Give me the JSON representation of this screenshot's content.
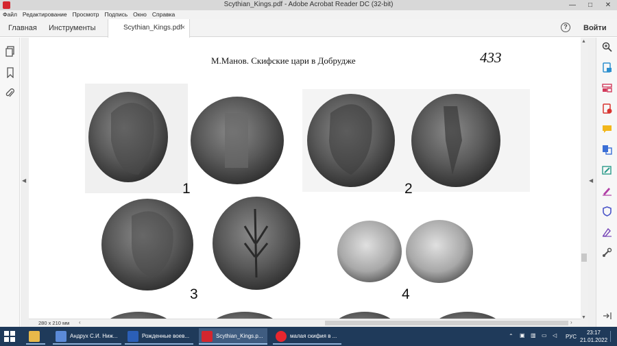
{
  "window": {
    "title": "Scythian_Kings.pdf - Adobe Acrobat Reader DC (32-bit)",
    "minimize": "—",
    "maximize": "□",
    "close": "✕"
  },
  "menu": [
    "Файл",
    "Редактирование",
    "Просмотр",
    "Подпись",
    "Окно",
    "Справка"
  ],
  "tabs": {
    "home": "Главная",
    "tools": "Инструменты",
    "document": "Scythian_Kings.pdf",
    "close_glyph": "×"
  },
  "header": {
    "help_glyph": "?",
    "login": "Войти"
  },
  "page": {
    "running_head": "М.Манов. Скифские цари в Добрудже",
    "page_number": "433",
    "coin_labels": [
      "1",
      "2",
      "3",
      "4"
    ]
  },
  "statusbar": {
    "page_size": "280 x 210 мм"
  },
  "left_tools": [
    "pages-icon",
    "bookmark-icon",
    "attachment-icon"
  ],
  "right_tools": [
    {
      "icon": "zoom-icon",
      "color": "#444444"
    },
    {
      "icon": "export-pdf-icon",
      "color": "#2c8fcf"
    },
    {
      "icon": "organize-pages-icon",
      "color": "#d23a5b"
    },
    {
      "icon": "create-pdf-icon",
      "color": "#d8342f"
    },
    {
      "icon": "comment-icon",
      "color": "#f2b71c"
    },
    {
      "icon": "combine-files-icon",
      "color": "#3b6fd6"
    },
    {
      "icon": "edit-pdf-icon",
      "color": "#2a9a8a"
    },
    {
      "icon": "fill-sign-icon",
      "color": "#b13fa6"
    },
    {
      "icon": "protect-icon",
      "color": "#4a55c8"
    },
    {
      "icon": "certificates-icon",
      "color": "#7a4ab8"
    },
    {
      "icon": "more-tools-icon",
      "color": "#555555"
    }
  ],
  "taskbar": {
    "items": [
      {
        "label": "",
        "color": "#e8b94a"
      },
      {
        "label": "Андрух С.И. Ниж...",
        "color": "#5b8ad8"
      },
      {
        "label": "Рожденные воев...",
        "color": "#2b5fb8"
      },
      {
        "label": "Scythian_Kings.p...",
        "color": "#d4262e"
      },
      {
        "label": "малая скифия в ...",
        "color": "#e8262e"
      }
    ],
    "language": "РУС",
    "time": "23:17",
    "date": "21.01.2022"
  }
}
